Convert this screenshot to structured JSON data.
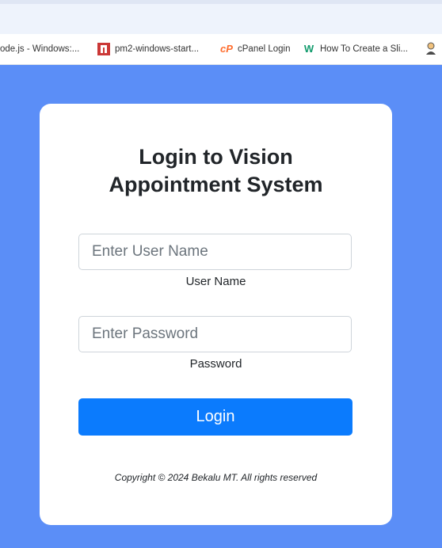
{
  "browser": {
    "bookmarks": [
      {
        "label": "ode.js - Windows:...",
        "icon": "none"
      },
      {
        "label": "pm2-windows-start...",
        "icon": "npm-icon"
      },
      {
        "label": "cPanel Login",
        "icon": "cpanel-icon"
      },
      {
        "label": "How To Create a Sli...",
        "icon": "w3schools-icon"
      }
    ]
  },
  "login": {
    "title_line1": "Login to Vision",
    "title_line2": "Appointment System",
    "username_placeholder": "Enter User Name",
    "username_label": "User Name",
    "password_placeholder": "Enter Password",
    "password_label": "Password",
    "login_button": "Login",
    "copyright": "Copyright © 2024 Bekalu MT. All rights reserved"
  },
  "colors": {
    "page_background": "#5b8ef7",
    "card_background": "#ffffff",
    "button_primary": "#0b7bfd"
  }
}
